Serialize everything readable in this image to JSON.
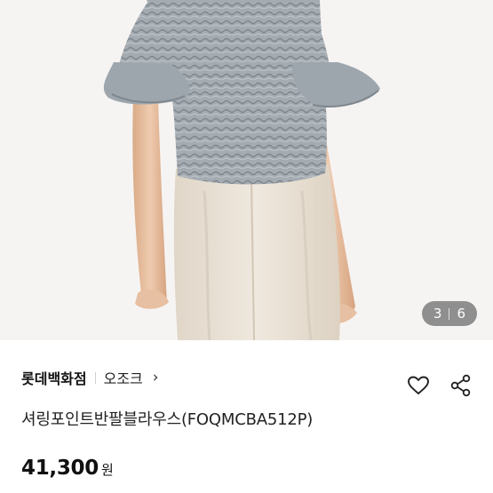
{
  "image_counter": {
    "current": "3",
    "total": "6"
  },
  "product": {
    "brand": "롯데백화점",
    "shop": "오조크",
    "chevron": "›",
    "title": "셔링포인트반팔블라우스(FOQMCBA512P)",
    "price": "41,300",
    "currency": "원"
  },
  "icons": {
    "like": "heart-icon",
    "share": "share-icon",
    "shop_link": "chevron-right-icon"
  },
  "colors": {
    "counter_bg": "#6e6e6e",
    "blouse": "#9aa2a8",
    "pants": "#e6ddd0",
    "mannequin": "#e2b99a"
  }
}
